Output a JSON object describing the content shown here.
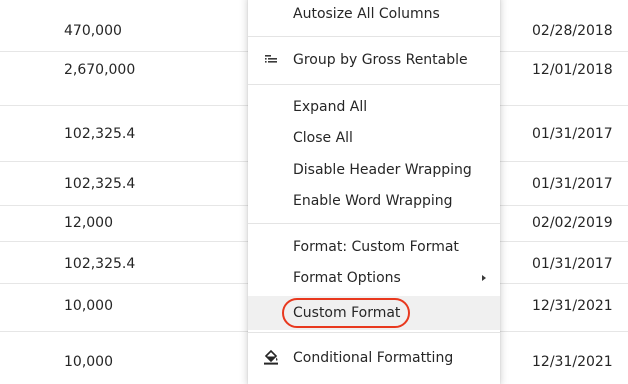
{
  "grid": {
    "rows": [
      {
        "value": "470,000",
        "date": "02/28/2018"
      },
      {
        "value": "2,670,000",
        "date": "12/01/2018"
      },
      {
        "value": "102,325.4",
        "date": "01/31/2017"
      },
      {
        "value": "102,325.4",
        "date": "01/31/2017"
      },
      {
        "value": "12,000",
        "date": "02/02/2019"
      },
      {
        "value": "102,325.4",
        "date": "01/31/2017"
      },
      {
        "value": "10,000",
        "date": "12/31/2021"
      },
      {
        "value": "10,000",
        "date": "12/31/2021"
      }
    ]
  },
  "menu": {
    "autosize": "Autosize All Columns",
    "group_by": "Group by Gross Rentable",
    "expand_all": "Expand All",
    "close_all": "Close All",
    "disable_header_wrapping": "Disable Header Wrapping",
    "enable_word_wrapping": "Enable Word Wrapping",
    "format_custom": "Format: Custom Format",
    "format_options": "Format Options",
    "custom_format": "Custom Format",
    "conditional_formatting": "Conditional Formatting",
    "icons": {
      "group_by": "group-rows-icon",
      "conditional_formatting": "paint-bucket-icon",
      "submenu": "caret-right-icon"
    },
    "highlight_color": "#e8381e"
  }
}
